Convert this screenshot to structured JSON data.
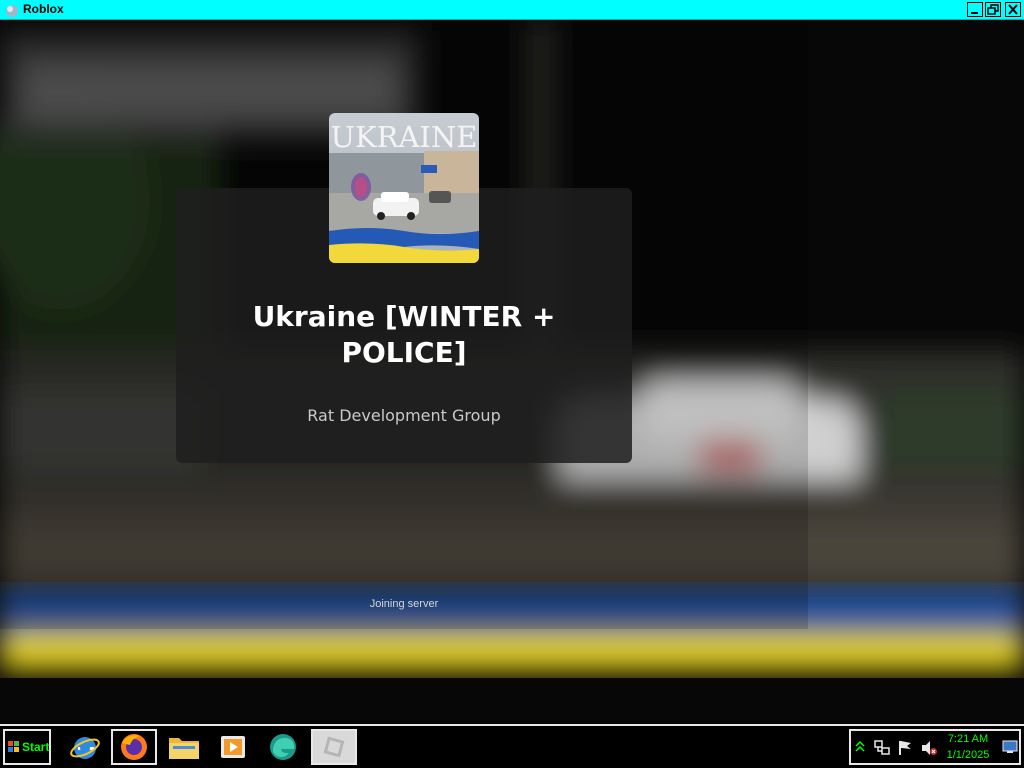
{
  "window": {
    "title": "Roblox",
    "app_icon": "roblox-icon",
    "controls": [
      "minimize-icon",
      "restore-icon",
      "close-icon"
    ]
  },
  "loading": {
    "thumbnail_text": "UKRAINE",
    "game_title": "Ukraine [WINTER + POLICE]",
    "creator": "Rat Development Group",
    "status": "Joining server"
  },
  "taskbar": {
    "start_label": "Start",
    "apps": [
      {
        "name": "internet-explorer-icon"
      },
      {
        "name": "firefox-icon",
        "active": true
      },
      {
        "name": "file-explorer-icon"
      },
      {
        "name": "media-player-icon"
      },
      {
        "name": "edge-icon"
      },
      {
        "name": "roblox-icon",
        "active": true
      }
    ],
    "tray": {
      "icons": [
        "show-hidden-icons-icon",
        "network-icon",
        "action-center-flag-icon",
        "volume-muted-icon"
      ],
      "time": "7:21 AM",
      "date": "1/1/2025",
      "show_desktop": "show-desktop-icon"
    }
  },
  "colors": {
    "titlebar": "#00ffff",
    "tray_text": "#00ff00",
    "start_text": "#00ff00",
    "flag_blue": "#1f5fc4",
    "flag_yellow": "#e6d21a"
  }
}
